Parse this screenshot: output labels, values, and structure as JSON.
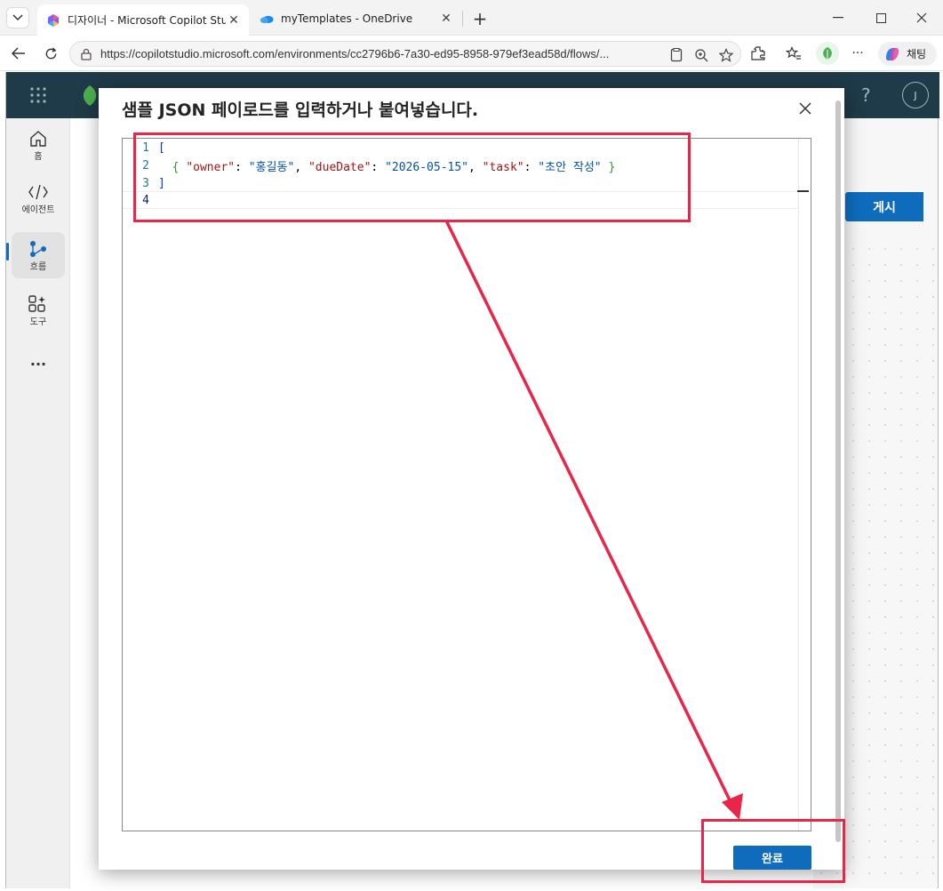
{
  "browser": {
    "tabs": [
      {
        "title": "디자이너 - Microsoft Copilot Studio",
        "active": true
      },
      {
        "title": "myTemplates - OneDrive",
        "active": false
      }
    ],
    "url": "https://copilotstudio.microsoft.com/environments/cc2796b6-7a30-ed95-8958-979ef3ead58d/flows/...",
    "copilot_label": "채팅"
  },
  "app": {
    "nav": [
      {
        "label": "홈",
        "icon": "home-icon"
      },
      {
        "label": "에이전트",
        "icon": "agent-icon"
      },
      {
        "label": "흐름",
        "icon": "flow-icon",
        "selected": true
      },
      {
        "label": "도구",
        "icon": "tools-icon"
      }
    ],
    "publish_label": "게시",
    "avatar_initial": "J",
    "help_glyph": "?"
  },
  "modal": {
    "title": "샘플 JSON 페이로드를 입력하거나 붙여넣습니다.",
    "done_label": "완료",
    "editor": {
      "lines": [
        {
          "number": "1"
        },
        {
          "number": "2",
          "owner_key": "\"owner\"",
          "owner_value": "\"홍길동\"",
          "due_key": "\"dueDate\"",
          "due_value": "\"2026-05-15\"",
          "task_key": "\"task\"",
          "task_value": "\"초안 작성\""
        },
        {
          "number": "3"
        },
        {
          "number": "4"
        }
      ]
    }
  },
  "colors": {
    "annotation": "#e8264a",
    "primary_button": "#0f6cbd",
    "app_header": "#1f3a48"
  }
}
